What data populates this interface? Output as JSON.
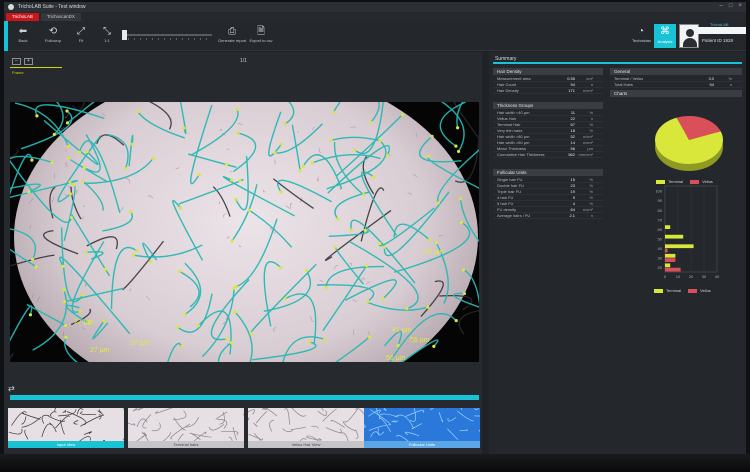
{
  "window": {
    "title": "TrichoLAB Suite - Test window",
    "controls": [
      "–",
      "□",
      "×"
    ]
  },
  "tabs": [
    {
      "label": "TrichoLAB",
      "active": true
    },
    {
      "label": "TrichoscanDX",
      "active": false
    }
  ],
  "toolbar": {
    "back_label": "Back",
    "rotate_label": "Followup",
    "zoom_label": "Fit",
    "fit_label": "1:1",
    "generate_label": "Generate report",
    "export_label": "Export to csv",
    "technician_label": "Technician",
    "analysis_label": "Analysis",
    "patient_label": "Patient ID",
    "patient_id": "1928",
    "brand": "TrichoLAB"
  },
  "viewer": {
    "counter": "1/1",
    "frame_label": "Frame",
    "progress": 1.0,
    "annotations": [
      "23 µm",
      "27 µm",
      "27 µm",
      "41 µm",
      "56 µm",
      "56 µm",
      "27 µm"
    ]
  },
  "thumbnails": [
    {
      "label": "Input View",
      "active": true
    },
    {
      "label": "Terminal hairs"
    },
    {
      "label": "Vellus Hair View"
    },
    {
      "label": "Follicular Units"
    }
  ],
  "summary": {
    "title": "Summary",
    "hair_density": {
      "head": "Hair Density",
      "rows": [
        {
          "name": "Measurement area",
          "value": "0.55",
          "unit": "cm²"
        },
        {
          "name": "Hair Count",
          "value": "94",
          "unit": "n"
        },
        {
          "name": "Hair Density",
          "value": "171",
          "unit": "n/cm²"
        }
      ]
    },
    "thickness": {
      "head": "Thickness Groups",
      "rows": [
        {
          "name": "Hair width <40 µm",
          "value": "11",
          "unit": "%"
        },
        {
          "name": "Vellus Hair",
          "value": "22",
          "unit": "n"
        },
        {
          "name": "Terminal Hair",
          "value": "67",
          "unit": "%"
        },
        {
          "name": "Very thin hairs",
          "value": "18",
          "unit": "%"
        },
        {
          "name": "Hair width >80 µm",
          "value": "52",
          "unit": "n/cm²"
        },
        {
          "name": "Hair width >60 µm",
          "value": "14",
          "unit": "n/cm²"
        },
        {
          "name": "Mean Thickness",
          "value": "56",
          "unit": "µm"
        },
        {
          "name": "Cumulative Hair Thickness",
          "value": "562",
          "unit": "mm/cm²"
        }
      ]
    },
    "follicular": {
      "head": "Follicular Units",
      "rows": [
        {
          "name": "Single hair FU",
          "value": "15",
          "unit": "%"
        },
        {
          "name": "Double hair FU",
          "value": "23",
          "unit": "%"
        },
        {
          "name": "Triple hair FU",
          "value": "19",
          "unit": "%"
        },
        {
          "name": "4 hair FU",
          "value": "9",
          "unit": "%"
        },
        {
          "name": "5 hair FU",
          "value": "4",
          "unit": "%"
        },
        {
          "name": "FU density",
          "value": "64",
          "unit": "n/cm²"
        },
        {
          "name": "Average hairs / FU",
          "value": "2.1",
          "unit": "n"
        }
      ]
    },
    "general": {
      "head": "General",
      "rows": [
        {
          "name": "Terminal / Vellus",
          "value": "3.0",
          "unit": "%"
        },
        {
          "name": "Total Hairs",
          "value": "94",
          "unit": "n"
        }
      ]
    },
    "charts_head": "Charts"
  },
  "chart_data": [
    {
      "type": "pie",
      "categories": [
        "Terminal",
        "Vellus"
      ],
      "values": [
        75,
        25
      ],
      "colors": [
        "#d9e63a",
        "#d9505a"
      ]
    },
    {
      "type": "bar",
      "orientation": "horizontal",
      "categories": [
        "100",
        "90",
        "80",
        "70",
        "60",
        "50",
        "40",
        "30",
        "20"
      ],
      "series": [
        {
          "name": "Terminal",
          "values": [
            0,
            0,
            0,
            0,
            4,
            14,
            22,
            8,
            4
          ]
        },
        {
          "name": "Vellus",
          "values": [
            0,
            0,
            0,
            0,
            0,
            0,
            2,
            8,
            12
          ]
        }
      ],
      "colors": [
        "#d9e63a",
        "#d9505a"
      ],
      "x_ticks": [
        "0",
        "10",
        "20",
        "30",
        "40"
      ],
      "xlim": [
        0,
        40
      ]
    }
  ]
}
